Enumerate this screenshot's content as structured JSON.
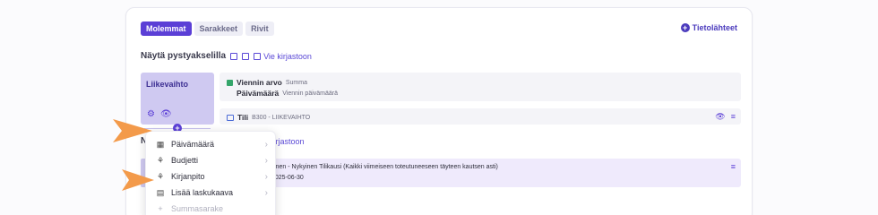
{
  "tabs": [
    {
      "label": "Molemmat",
      "active": true
    },
    {
      "label": "Sarakkeet",
      "active": false
    },
    {
      "label": "Rivit",
      "active": false
    }
  ],
  "data_sources_label": "Tietolähteet",
  "section_title": "Näytä pystyakselilla",
  "export_link": "Vie kirjastoon",
  "card": {
    "title": "Liikevaihto"
  },
  "row1": {
    "line1_bold": "Viennin arvo",
    "line1_muted": "Summa",
    "line2_bold": "Päivämäärä",
    "line2_muted": "Viennin päivämäärä"
  },
  "row2": {
    "bold": "Tili",
    "muted": "B300 - LIIKEVAIHTO"
  },
  "second_section_partial": "N",
  "second_export_link": "kirjastoon",
  "row3": {
    "line1": "i  Edellinen - Nykyinen Tilikausi (Kaikki viimeiseen toteutuneeseen täyteen kautsen asti)",
    "line2": "2025-06-30"
  },
  "menu": {
    "items": [
      {
        "label": "Päivämäärä",
        "icon": "calendar-icon",
        "chevron": true
      },
      {
        "label": "Budjetti",
        "icon": "sprout-icon",
        "chevron": true
      },
      {
        "label": "Kirjanpito",
        "icon": "sprout-icon",
        "chevron": true
      },
      {
        "label": "Lisää laskukaava",
        "icon": "calculator-icon",
        "chevron": true
      },
      {
        "label": "Summasarake",
        "icon": "plus-icon",
        "chevron": false
      }
    ]
  },
  "colors": {
    "accent": "#5b3fd6",
    "card": "#cfc9f1",
    "arrow": "#f39a4a"
  }
}
